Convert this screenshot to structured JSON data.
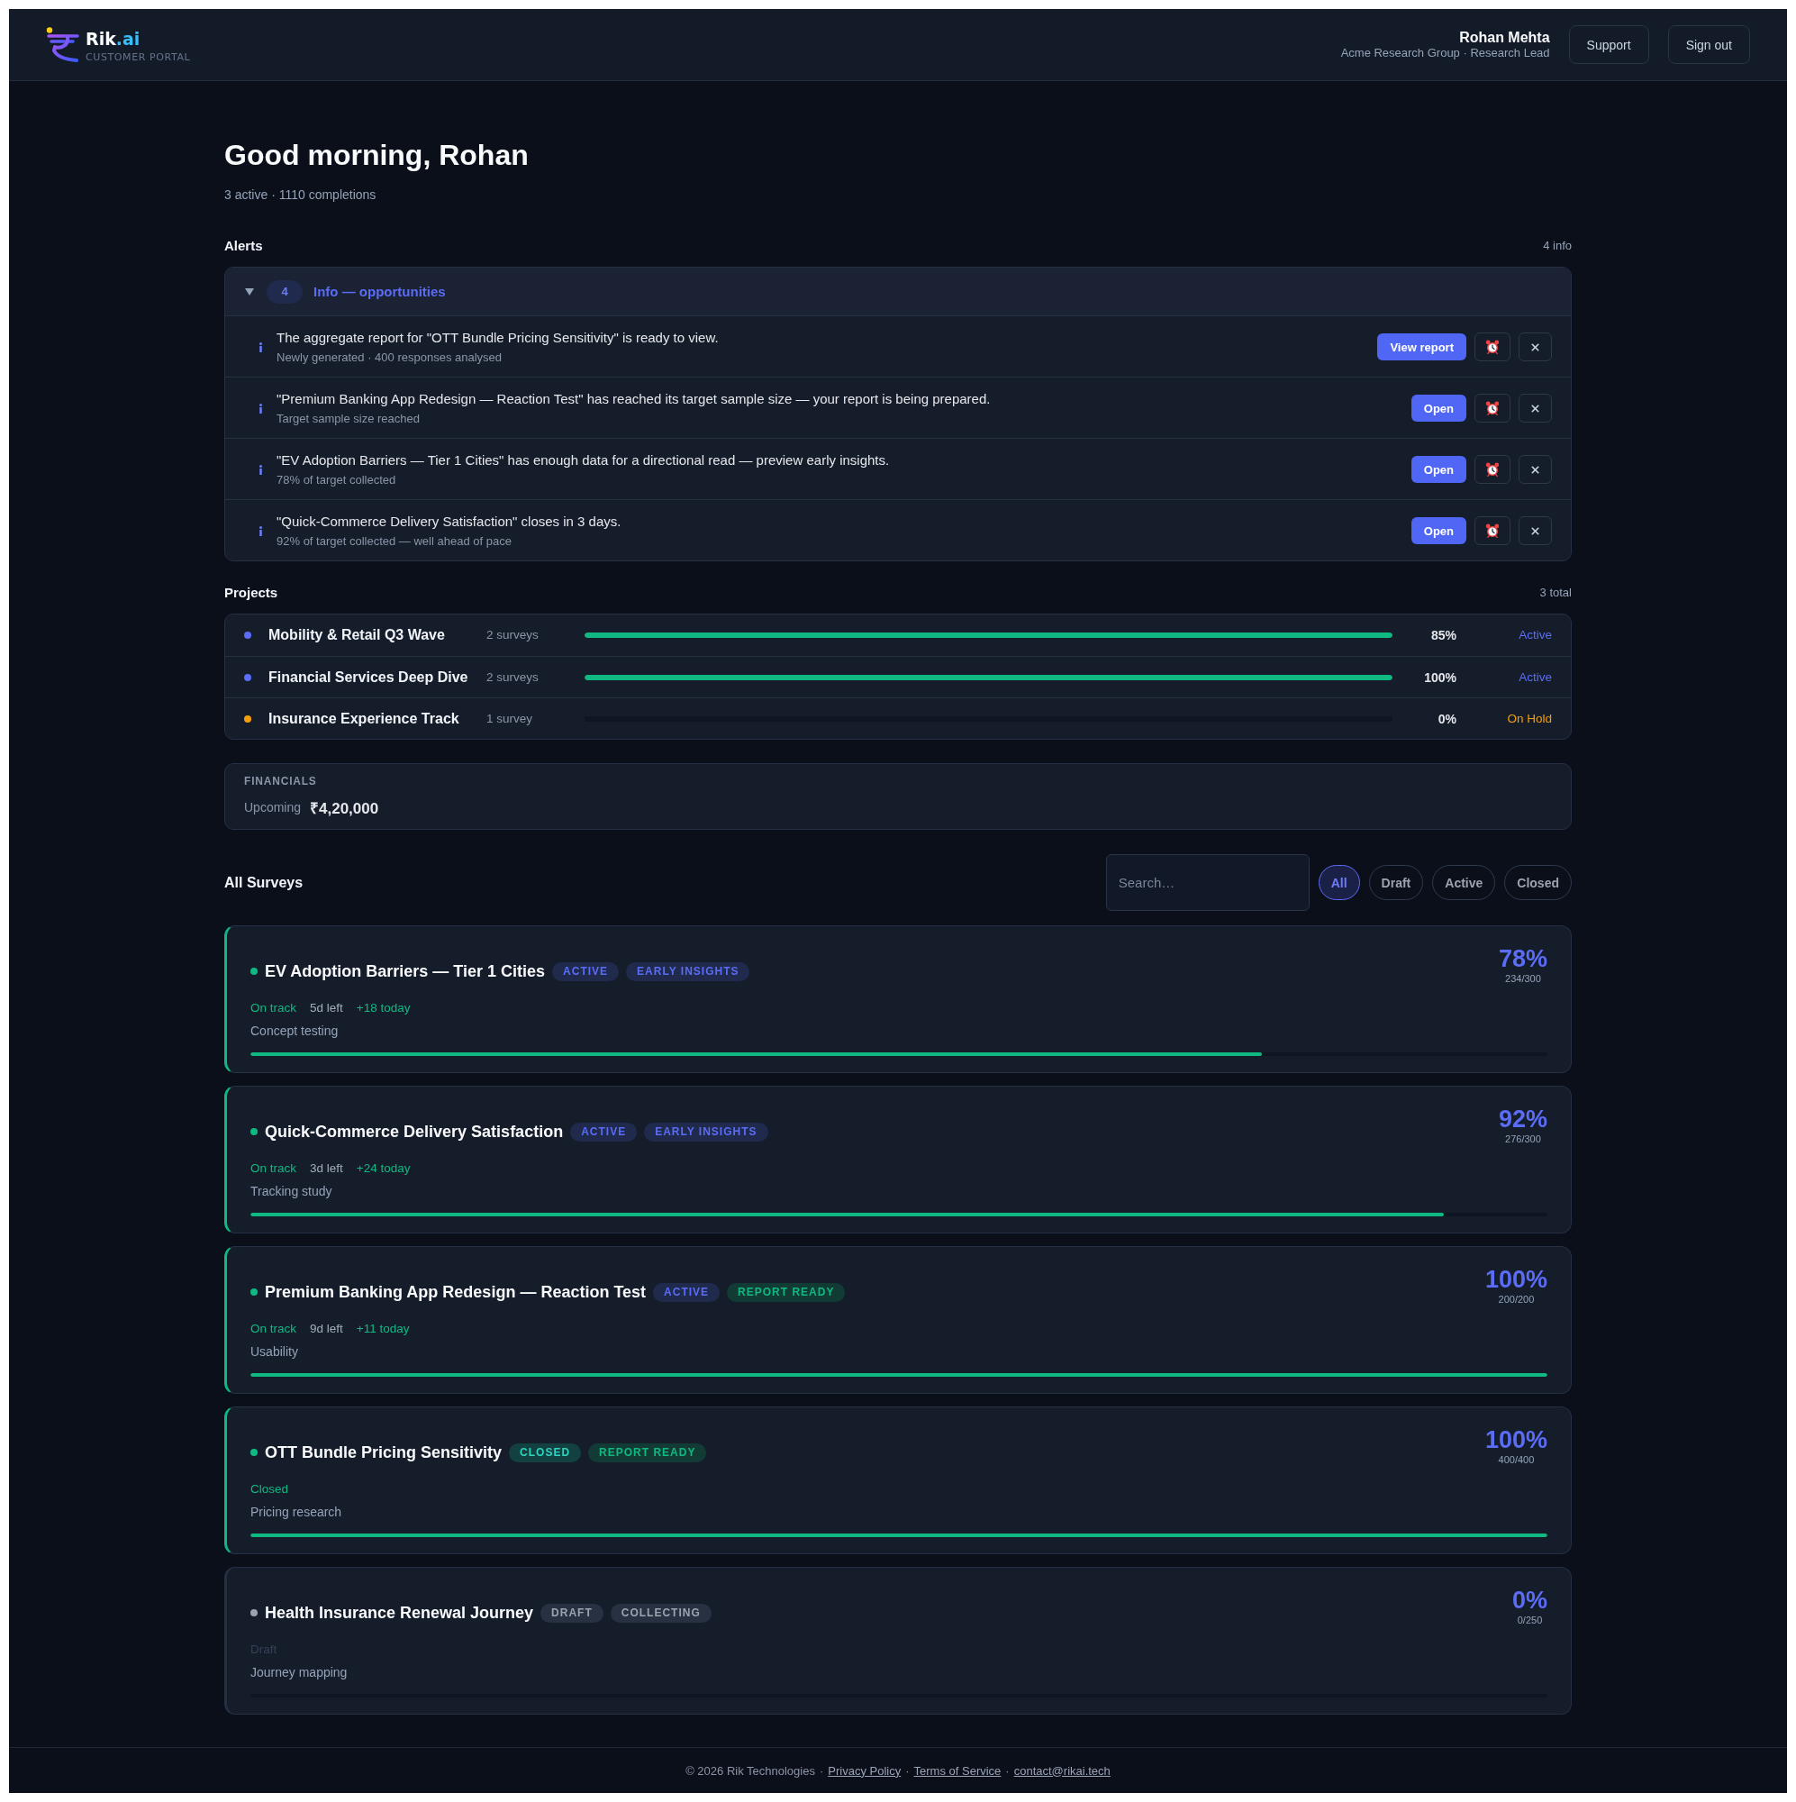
{
  "header": {
    "brand": {
      "name": "Rik",
      "accent": ".ai"
    },
    "tagline": "CUSTOMER PORTAL",
    "user": {
      "name": "Rohan Mehta",
      "role": "Acme Research Group · Research Lead"
    },
    "buttons": [
      "Support",
      "Sign out"
    ]
  },
  "greeting": {
    "title": "Good morning, Rohan",
    "summary": "3 active · 1110 completions"
  },
  "alerts": {
    "title": "Alerts",
    "count": "4 info",
    "group": {
      "count": "4",
      "title": "Info — opportunities",
      "expanded": true,
      "items": [
        {
          "message": "The aggregate report for \"OTT Bundle Pricing Sensitivity\" is ready to view.",
          "detail": "Newly generated · 400 responses analysed",
          "action": "View report"
        },
        {
          "message": "\"Premium Banking App Redesign — Reaction Test\" has reached its target sample size — your report is being prepared.",
          "detail": "Target sample size reached",
          "action": "Open"
        },
        {
          "message": "\"EV Adoption Barriers — Tier 1 Cities\" has enough data for a directional read — preview early insights.",
          "detail": "78% of target collected",
          "action": "Open"
        },
        {
          "message": "\"Quick-Commerce Delivery Satisfaction\" closes in 3 days.",
          "detail": "92% of target collected — well ahead of pace",
          "action": "Open"
        }
      ]
    }
  },
  "projects": {
    "title": "Projects",
    "count": "3 total",
    "rows": [
      {
        "name": "Mobility & Retail Q3 Wave",
        "surveys": "2 surveys",
        "level": 1,
        "percent": "85%",
        "status": "Active",
        "color": "#5b6cf6"
      },
      {
        "name": "Financial Services Deep Dive",
        "surveys": "2 surveys",
        "level": 1,
        "percent": "100%",
        "status": "Active",
        "color": "#5b6cf6"
      },
      {
        "name": "Insurance Experience Track",
        "surveys": "1 survey",
        "level": 0,
        "percent": "0%",
        "status": "On Hold",
        "color": "#f59e0b"
      }
    ]
  },
  "financials": {
    "title": "FINANCIALS",
    "label": "Upcoming",
    "amount": "₹4,20,000"
  },
  "surveys_section": {
    "title": "All Surveys",
    "search": {
      "placeholder": "Search…"
    },
    "filters": [
      {
        "label": "All",
        "selected": true
      },
      {
        "label": "Draft",
        "selected": false
      },
      {
        "label": "Active",
        "selected": false
      },
      {
        "label": "Closed",
        "selected": false
      }
    ]
  },
  "surveys": [
    {
      "title": "EV Adoption Barriers — Tier 1 Cities",
      "color": "#10b981",
      "highlighted": true,
      "tags": [
        {
          "label": "ACTIVE",
          "kind": "active"
        },
        {
          "label": "EARLY INSIGHTS",
          "kind": "insight"
        }
      ],
      "meta": [
        {
          "label": "On track",
          "color": "#10b981"
        },
        {
          "label": "5d left",
          "color": "#a3acb9"
        },
        {
          "label": "+18 today",
          "color": "#10b981"
        }
      ],
      "description": "Concept testing",
      "percent": "78%",
      "count": "234/300",
      "level": 0.78
    },
    {
      "title": "Quick-Commerce Delivery Satisfaction",
      "color": "#10b981",
      "highlighted": true,
      "tags": [
        {
          "label": "ACTIVE",
          "kind": "active"
        },
        {
          "label": "EARLY INSIGHTS",
          "kind": "insight"
        }
      ],
      "meta": [
        {
          "label": "On track",
          "color": "#10b981"
        },
        {
          "label": "3d left",
          "color": "#a3acb9"
        },
        {
          "label": "+24 today",
          "color": "#10b981"
        }
      ],
      "description": "Tracking study",
      "percent": "92%",
      "count": "276/300",
      "level": 0.92
    },
    {
      "title": "Premium Banking App Redesign — Reaction Test",
      "color": "#10b981",
      "highlighted": true,
      "tags": [
        {
          "label": "ACTIVE",
          "kind": "active"
        },
        {
          "label": "REPORT READY",
          "kind": "ready"
        }
      ],
      "meta": [
        {
          "label": "On track",
          "color": "#10b981"
        },
        {
          "label": "9d left",
          "color": "#a3acb9"
        },
        {
          "label": "+11 today",
          "color": "#10b981"
        }
      ],
      "description": "Usability",
      "percent": "100%",
      "count": "200/200",
      "level": 1
    },
    {
      "title": "OTT Bundle Pricing Sensitivity",
      "color": "#10b981",
      "highlighted": true,
      "tags": [
        {
          "label": "CLOSED",
          "kind": "closed"
        },
        {
          "label": "REPORT READY",
          "kind": "ready"
        }
      ],
      "meta": [
        {
          "label": "Closed",
          "color": "#10b981"
        }
      ],
      "description": "Pricing research",
      "percent": "100%",
      "count": "400/400",
      "level": 1
    },
    {
      "title": "Health Insurance Renewal Journey",
      "color": "#9ca3af",
      "highlighted": false,
      "tags": [
        {
          "label": "DRAFT",
          "kind": "draft"
        },
        {
          "label": "COLLECTING",
          "kind": "draft"
        }
      ],
      "meta": [
        {
          "label": "Draft",
          "color": "#334155"
        }
      ],
      "description": "Journey mapping",
      "percent": "0%",
      "count": "0/250",
      "level": 0
    }
  ],
  "footer": {
    "items": [
      {
        "kind": "text",
        "label": "© 2026 Rik Technologies"
      },
      {
        "kind": "text",
        "label": "·"
      },
      {
        "kind": "link",
        "label": "Privacy Policy"
      },
      {
        "kind": "text",
        "label": "·"
      },
      {
        "kind": "link",
        "label": "Terms of Service"
      },
      {
        "kind": "text",
        "label": "·"
      },
      {
        "kind": "link",
        "label": "contact@rikai.tech"
      }
    ]
  }
}
